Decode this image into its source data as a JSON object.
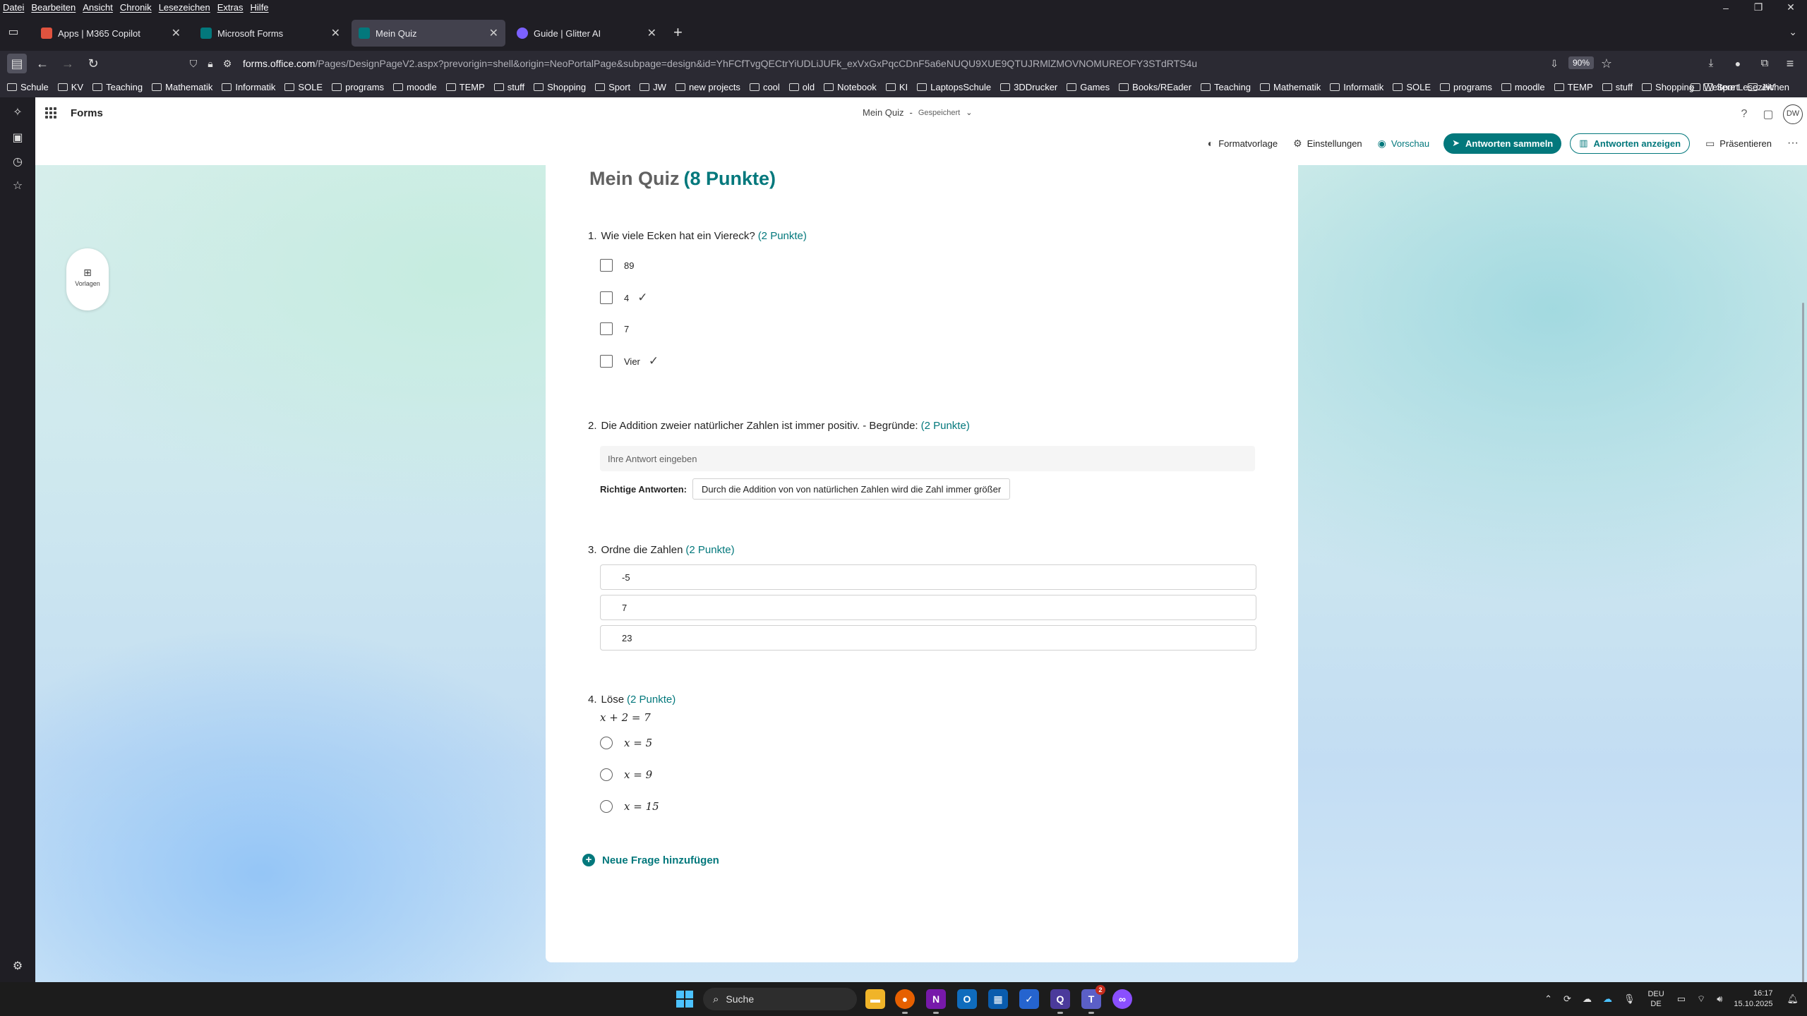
{
  "menubar": {
    "items": [
      "Datei",
      "Bearbeiten",
      "Ansicht",
      "Chronik",
      "Lesezeichen",
      "Extras",
      "Hilfe"
    ]
  },
  "tabs": [
    {
      "title": "Apps | M365 Copilot",
      "color": "#e0533f"
    },
    {
      "title": "Microsoft Forms",
      "color": "#03787c"
    },
    {
      "title": "Mein Quiz",
      "color": "#03787c"
    },
    {
      "title": "Guide | Glitter AI",
      "color": "#7b61ff"
    }
  ],
  "address": {
    "url_host": "forms.office.com",
    "url_path": "/Pages/DesignPageV2.aspx?prevorigin=shell&origin=NeoPortalPage&subpage=design&id=YhFCfTvgQECtrYiUDLiJUFk_exVxGxPqcCDnF5a6eNUQU9XUE9QTUJRMlZMOVNOMUREOFY3STdRTS4u",
    "zoom": "90%"
  },
  "bookmarks": [
    "Schule",
    "KV",
    "Teaching",
    "Mathematik",
    "Informatik",
    "SOLE",
    "programs",
    "moodle",
    "TEMP",
    "stuff",
    "Shopping",
    "Sport",
    "JW",
    "new projects",
    "cool",
    "old",
    "Notebook",
    "KI",
    "LaptopsSchule",
    "3DDrucker",
    "Games",
    "Books/REader",
    "Teaching",
    "Mathematik",
    "Informatik",
    "SOLE",
    "programs",
    "moodle",
    "TEMP",
    "stuff",
    "Shopping",
    "Sport",
    "JW"
  ],
  "bookmarks_other": "Weitere Lesezeichen",
  "forms": {
    "app_name": "Forms",
    "doc_title": "Mein Quiz",
    "doc_separator": "-",
    "doc_status": "Gespeichert",
    "avatar": "DW",
    "commands": {
      "theme": "Formatvorlage",
      "settings": "Einstellungen",
      "preview": "Vorschau",
      "collect": "Antworten sammeln",
      "view_responses": "Antworten anzeigen",
      "present": "Präsentieren"
    },
    "templates_label": "Vorlagen",
    "accent": "#03787c"
  },
  "quiz": {
    "title": "Mein Quiz",
    "title_points": "(8 Punkte)",
    "questions": [
      {
        "num": "1.",
        "text": "Wie viele Ecken hat ein Viereck?",
        "points": "(2 Punkte)",
        "options": [
          "89",
          "4",
          "7",
          "Vier"
        ]
      },
      {
        "num": "2.",
        "text": "Die Addition zweier natürlicher Zahlen ist immer positiv. - Begründe:",
        "points": "(2 Punkte)",
        "placeholder": "Ihre Antwort eingeben",
        "correct_label": "Richtige Antworten:",
        "correct_answer": "Durch die Addition von von natürlichen Zahlen wird die Zahl immer größer"
      },
      {
        "num": "3.",
        "text": "Ordne die Zahlen",
        "points": "(2 Punkte)",
        "items": [
          "-5",
          "7",
          "23"
        ]
      },
      {
        "num": "4.",
        "text": "Löse",
        "points": "(2 Punkte)",
        "equation": "x + 2 = 7",
        "options": [
          "x = 5",
          "x = 9",
          "x = 15"
        ]
      }
    ],
    "add_question": "Neue Frage hinzufügen"
  },
  "taskbar": {
    "search": "Suche",
    "teams_badge": "2",
    "lang_top": "DEU",
    "lang_bottom": "DE",
    "time": "16:17",
    "date": "15.10.2025"
  }
}
